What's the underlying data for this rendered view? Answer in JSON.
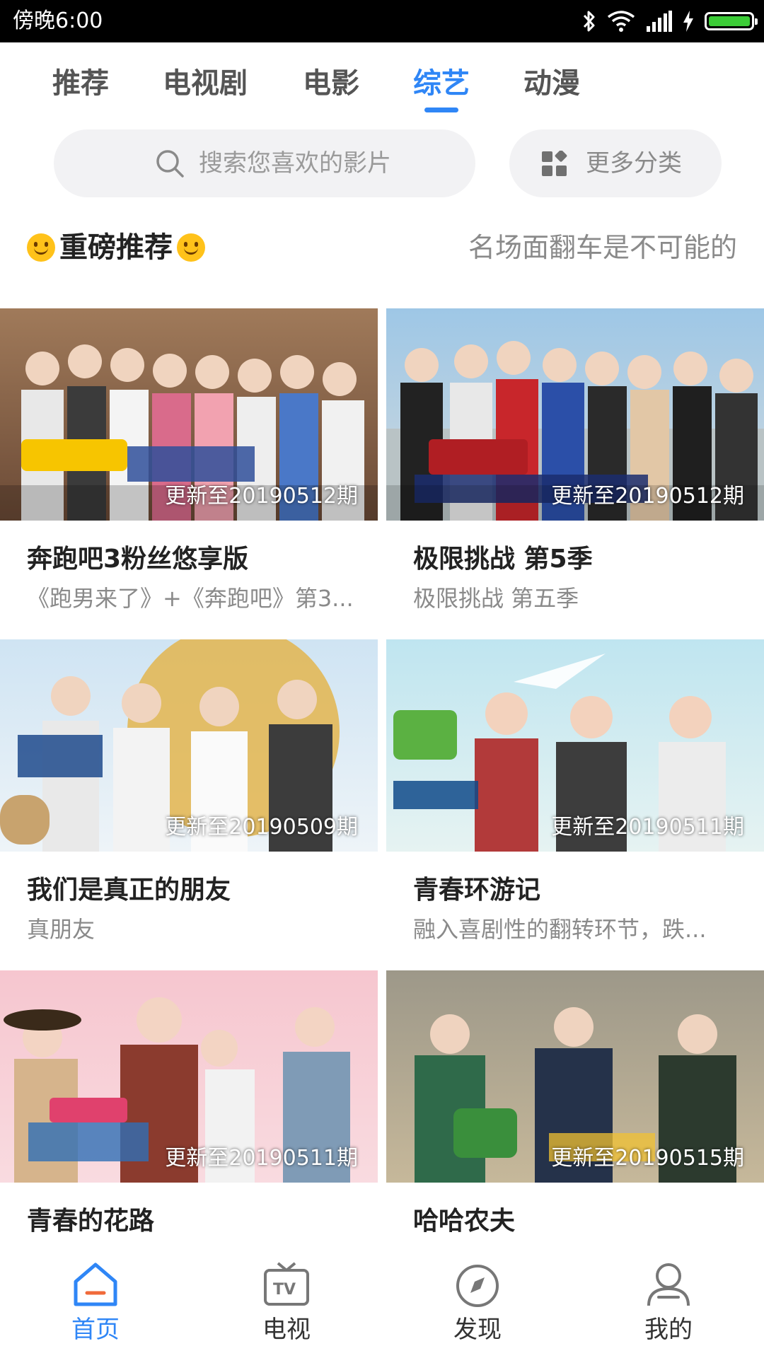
{
  "status_bar": {
    "time": "傍晚6:00",
    "battery_color": "#3ccc37"
  },
  "tabs": [
    {
      "label": "推荐"
    },
    {
      "label": "电视剧"
    },
    {
      "label": "电影"
    },
    {
      "label": "综艺",
      "active": true
    },
    {
      "label": "动漫"
    }
  ],
  "search": {
    "placeholder": "搜索您喜欢的影片",
    "icon": "search-icon"
  },
  "more_category": {
    "label": "更多分类",
    "icon": "grid-icon"
  },
  "section": {
    "title": "重磅推荐",
    "tagline": "名场面翻车是不可能的"
  },
  "cards": [
    {
      "title": "奔跑吧3粉丝悠享版",
      "subtitle": "《跑男来了》+《奔跑吧》第3...",
      "badge": "更新至20190512期"
    },
    {
      "title": "极限挑战 第5季",
      "subtitle": "极限挑战 第五季",
      "badge": "更新至20190512期"
    },
    {
      "title": "我们是真正的朋友",
      "subtitle": "真朋友",
      "badge": "更新至20190509期"
    },
    {
      "title": "青春环游记",
      "subtitle": "融入喜剧性的翻转环节，跌...",
      "badge": "更新至20190511期"
    },
    {
      "title": "青春的花路",
      "subtitle": "",
      "badge": "更新至20190511期"
    },
    {
      "title": "哈哈农夫",
      "subtitle": "",
      "badge": "更新至20190515期"
    }
  ],
  "bottom_nav": [
    {
      "label": "首页",
      "icon": "home-icon",
      "active": true
    },
    {
      "label": "电视",
      "icon": "tv-icon"
    },
    {
      "label": "发现",
      "icon": "compass-icon"
    },
    {
      "label": "我的",
      "icon": "user-icon"
    }
  ],
  "colors": {
    "accent": "#2f86f6",
    "muted_text": "#8a8a8a",
    "search_bg": "#f2f2f4"
  }
}
